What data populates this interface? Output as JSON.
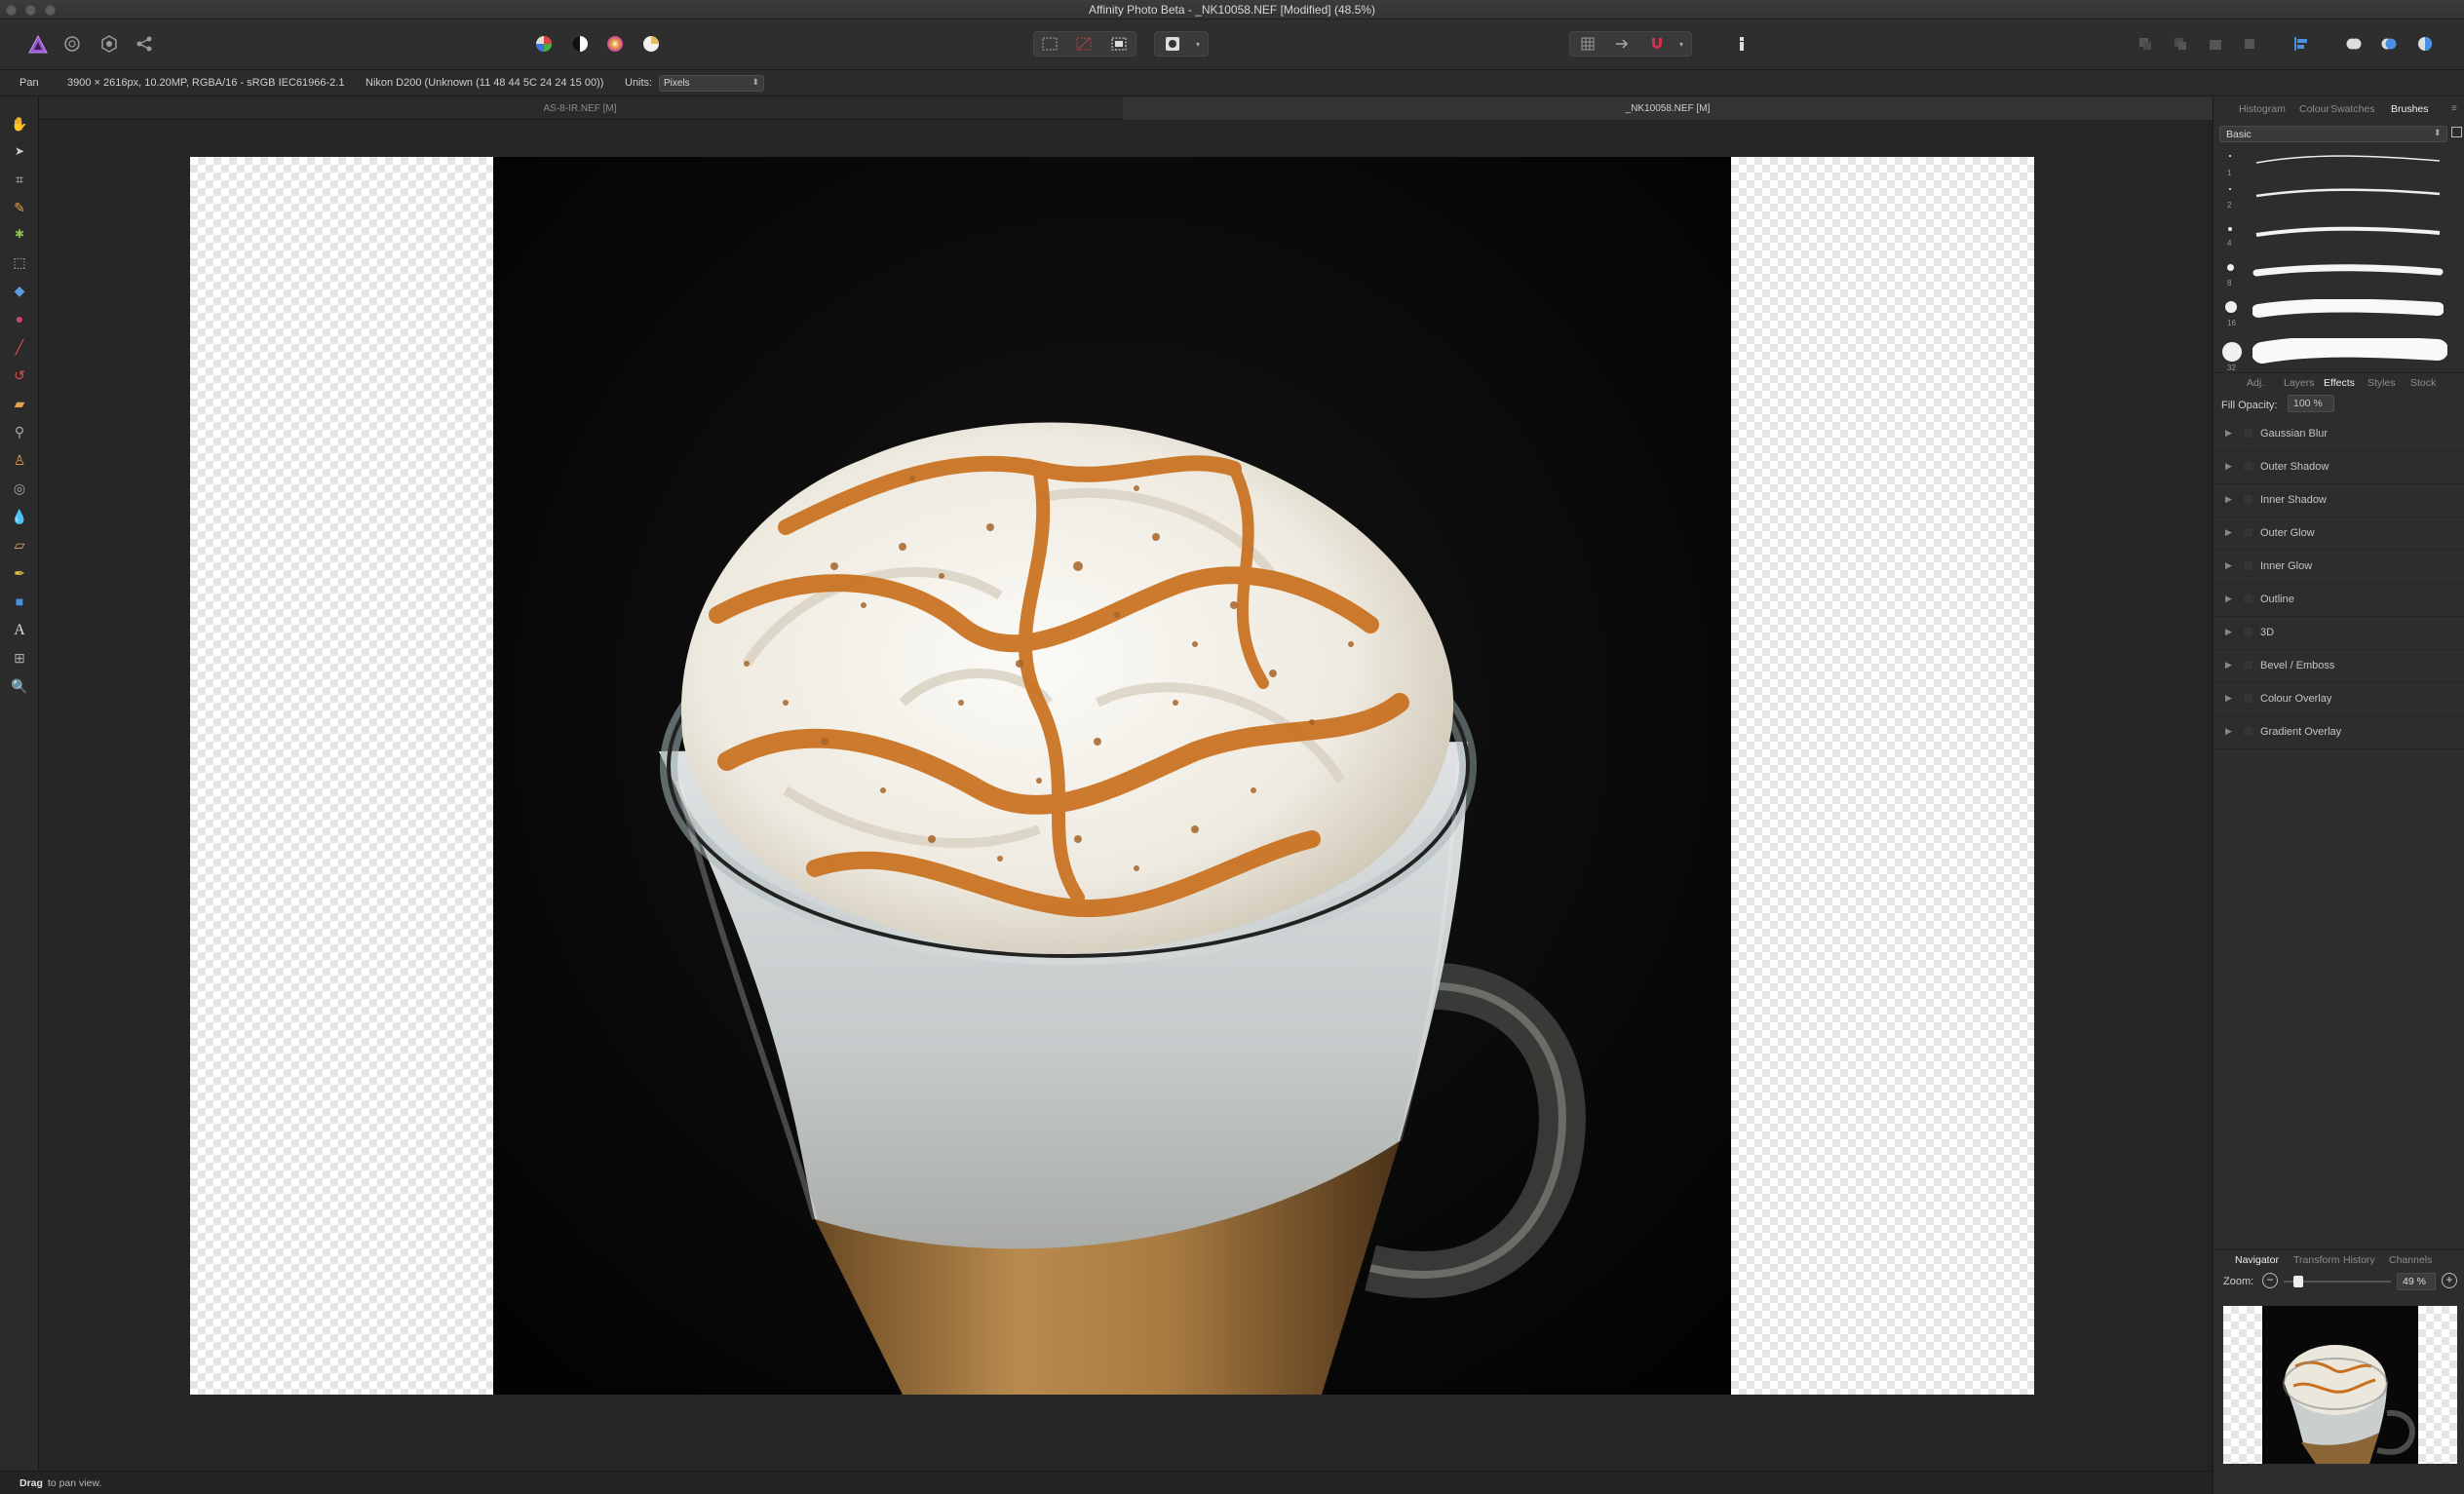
{
  "window": {
    "title": "Affinity Photo Beta - _NK10058.NEF [Modified] (48.5%)"
  },
  "context": {
    "tool_name": "Pan",
    "image_info": "3900 × 2616px, 10.20MP, RGBA/16 - sRGB IEC61966-2.1",
    "camera_info": "Nikon D200 (Unknown (11 48 44 5C 24 24 15 00))",
    "units_label": "Units:",
    "units_value": "Pixels"
  },
  "doc_tabs": [
    {
      "label": "AS-8-IR.NEF [M]",
      "active": false
    },
    {
      "label": "_NK10058.NEF [M]",
      "active": true
    }
  ],
  "panel_top": {
    "tabs": [
      "Histogram",
      "Colour",
      "Swatches",
      "Brushes"
    ],
    "active": "Brushes",
    "category": "Basic",
    "brush_sizes": [
      "1",
      "2",
      "4",
      "8",
      "16",
      "32"
    ]
  },
  "panel_mid": {
    "tabs": [
      "Adj.",
      "Layers",
      "Effects",
      "Styles",
      "Stock"
    ],
    "active": "Effects",
    "fill_opacity_label": "Fill Opacity:",
    "fill_opacity_value": "100 %",
    "effects": [
      "Gaussian Blur",
      "Outer Shadow",
      "Inner Shadow",
      "Outer Glow",
      "Inner Glow",
      "Outline",
      "3D",
      "Bevel / Emboss",
      "Colour Overlay",
      "Gradient Overlay"
    ]
  },
  "panel_bottom": {
    "tabs": [
      "Navigator",
      "Transform",
      "History",
      "Channels"
    ],
    "active": "Navigator",
    "zoom_label": "Zoom:",
    "zoom_value": "49 %"
  },
  "status": {
    "bold": "Drag",
    "text": " to pan view."
  },
  "icons": {
    "toolbar": [
      "affinity-photo-persona-icon",
      "liquify-persona-icon",
      "develop-persona-icon",
      "export-persona-icon",
      "auto-levels-icon",
      "auto-contrast-icon",
      "auto-colour-icon",
      "auto-white-balance-icon",
      "selection-icons",
      "quick-mask-icon",
      "snapping-icons",
      "assistant-icon",
      "arrange-icons",
      "align-icon",
      "boolean-icons"
    ],
    "tools": [
      "hand-icon",
      "move-icon",
      "crop-icon",
      "selection-brush-icon",
      "flood-select-icon",
      "marquee-icon",
      "flood-fill-icon",
      "gradient-icon",
      "paint-brush-icon",
      "colour-replacement-icon",
      "erase-brush-icon",
      "dodge-icon",
      "clone-icon",
      "red-eye-icon",
      "blur-brush-icon",
      "healing-brush-icon",
      "pen-icon",
      "shape-icon",
      "text-icon",
      "mesh-warp-icon",
      "zoom-icon"
    ]
  }
}
